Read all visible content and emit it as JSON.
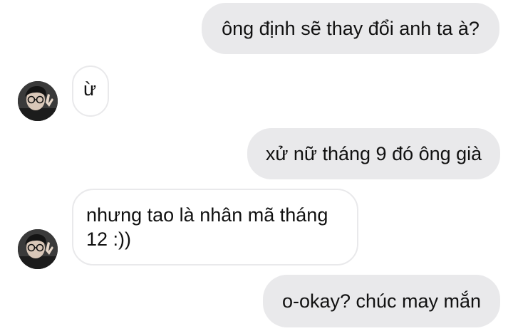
{
  "messages": [
    {
      "direction": "outgoing",
      "text": "ông định sẽ thay đổi anh ta à?"
    },
    {
      "direction": "incoming",
      "text": "ừ"
    },
    {
      "direction": "outgoing",
      "text": "xử nữ tháng 9 đó ông già"
    },
    {
      "direction": "incoming",
      "text": "nhưng tao là nhân mã tháng 12 :))"
    },
    {
      "direction": "outgoing",
      "text": "o-okay? chúc may mắn"
    }
  ],
  "colors": {
    "outgoing_bubble": "#e9e9eb",
    "incoming_border": "#e9e9eb",
    "text": "#111111",
    "background": "#ffffff"
  },
  "icons": {
    "avatar": "user-avatar-icon"
  }
}
